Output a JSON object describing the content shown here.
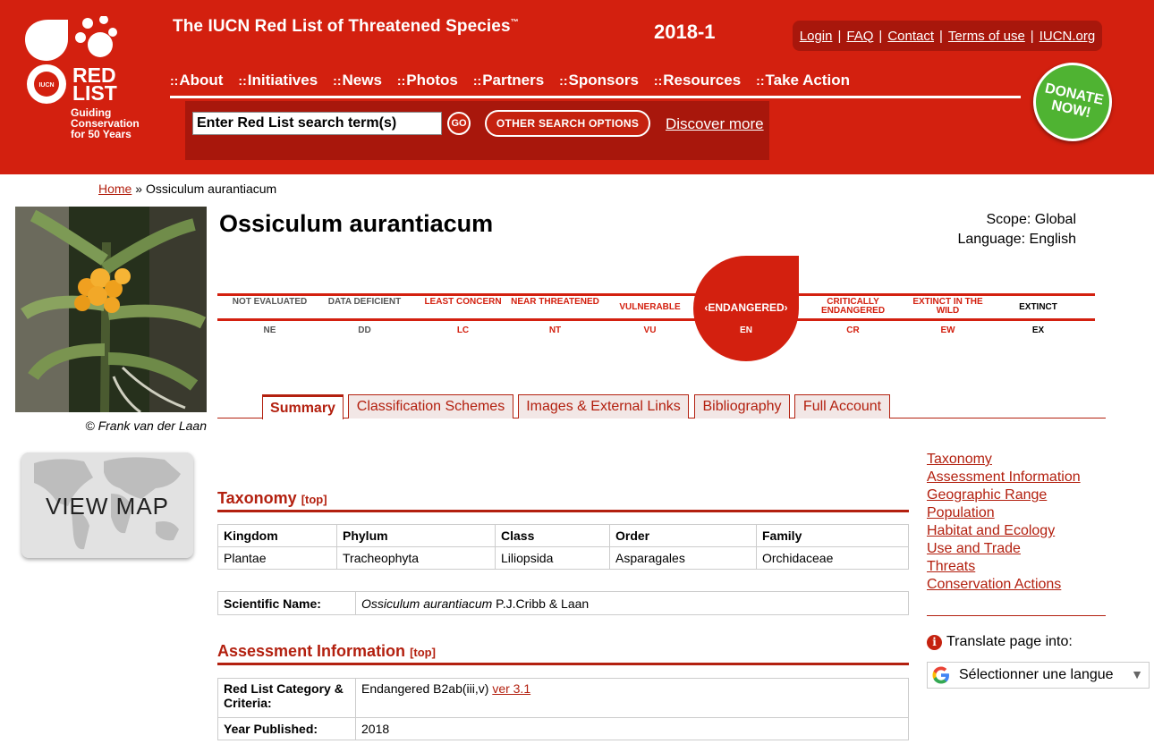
{
  "header": {
    "logo_text": "RED LIST",
    "logo_tagline": "Guiding Conservation for 50 Years",
    "site_title": "The IUCN Red List of Threatened Species",
    "trademark": "™",
    "version": "2018-1",
    "utility_links": [
      "Login",
      "FAQ",
      "Contact",
      "Terms of use",
      "IUCN.org"
    ],
    "nav": [
      "About",
      "Initiatives",
      "News",
      "Photos",
      "Partners",
      "Sponsors",
      "Resources",
      "Take Action"
    ],
    "search": {
      "value": "Enter Red List search term(s)",
      "go_label": "GO",
      "other_options_label": "OTHER SEARCH OPTIONS",
      "discover_label": "Discover more"
    },
    "donate_label": "DONATE NOW!"
  },
  "breadcrumb": {
    "home": "Home",
    "separator": "»",
    "current": "Ossiculum aurantiacum"
  },
  "photo_credit": "© Frank van der Laan",
  "view_map_label": "VIEW MAP",
  "species": {
    "title": "Ossiculum aurantiacum",
    "scope": "Scope: Global",
    "language": "Language: English"
  },
  "scale": {
    "categories": [
      {
        "name": "NOT EVALUATED",
        "abbr": "NE"
      },
      {
        "name": "DATA DEFICIENT",
        "abbr": "DD"
      },
      {
        "name": "LEAST CONCERN",
        "abbr": "LC"
      },
      {
        "name": "NEAR THREATENED",
        "abbr": "NT"
      },
      {
        "name": "VULNERABLE",
        "abbr": "VU"
      },
      {
        "name": "ENDANGERED",
        "abbr": "EN"
      },
      {
        "name": "CRITICALLY ENDANGERED",
        "abbr": "CR"
      },
      {
        "name": "EXTINCT IN THE WILD",
        "abbr": "EW"
      },
      {
        "name": "EXTINCT",
        "abbr": "EX"
      }
    ],
    "selected": "ENDANGERED",
    "selected_display": "ENDANGERED",
    "colors": {
      "accent": "#d3200f",
      "grey": "#555555",
      "black": "#000000"
    }
  },
  "tabs": [
    "Summary",
    "Classification Schemes",
    "Images & External Links",
    "Bibliography",
    "Full Account"
  ],
  "taxonomy": {
    "heading": "Taxonomy",
    "top_link": "[top]",
    "columns": [
      "Kingdom",
      "Phylum",
      "Class",
      "Order",
      "Family"
    ],
    "values": [
      "Plantae",
      "Tracheophyta",
      "Liliopsida",
      "Asparagales",
      "Orchidaceae"
    ],
    "scientific_name_label": "Scientific Name:",
    "scientific_name": "Ossiculum aurantiacum",
    "authority": "P.J.Cribb & Laan"
  },
  "assessment": {
    "heading": "Assessment Information",
    "top_link": "[top]",
    "category_label": "Red List Category & Criteria:",
    "category_value": "Endangered B2ab(iii,v)",
    "version_link": "ver 3.1",
    "year_label": "Year Published:",
    "year_value": "2018"
  },
  "sidebar": {
    "toc": [
      "Taxonomy",
      "Assessment Information",
      "Geographic Range",
      "Population",
      "Habitat and Ecology",
      "Use and Trade",
      "Threats",
      "Conservation Actions"
    ],
    "translate_label": "Translate page into:",
    "language_select": "Sélectionner une langue"
  },
  "colors": {
    "brand_red": "#d3200f",
    "dark_red": "#a8170c",
    "link_red": "#b3200f",
    "donate_green": "#4fb332"
  }
}
